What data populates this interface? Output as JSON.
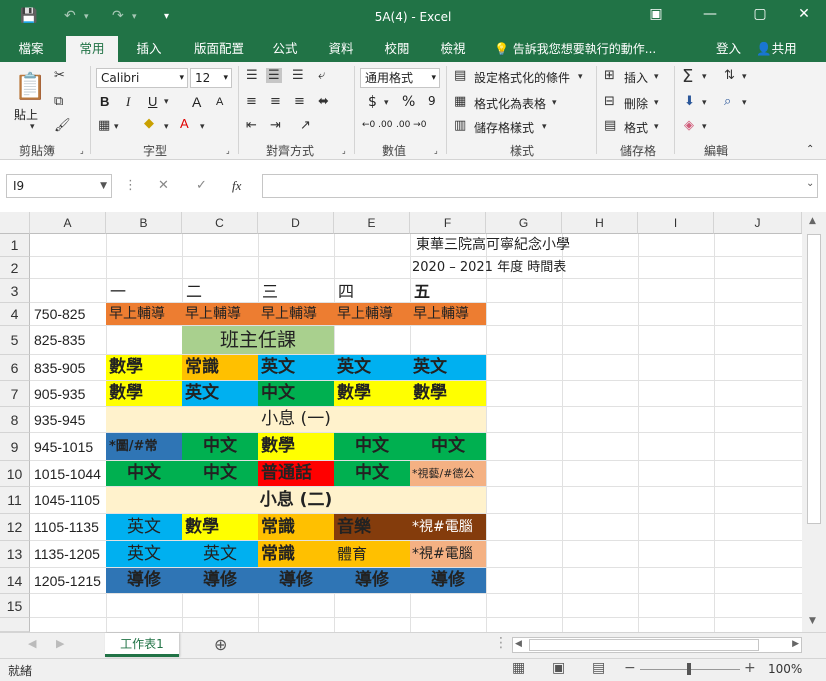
{
  "window": {
    "title": "5A(4)  -  Excel"
  },
  "qa": {
    "save_icon": "save-icon",
    "undo_icon": "undo-icon",
    "redo_icon": "redo-icon",
    "customize_icon": "customize-icon"
  },
  "ribbon_tabs": [
    "檔案",
    "常用",
    "插入",
    "版面配置",
    "公式",
    "資料",
    "校閱",
    "檢視"
  ],
  "tell_me": "告訴我您想要執行的動作...",
  "account": {
    "signin": "登入",
    "share": "共用"
  },
  "ribbon": {
    "clipboard": {
      "paste": "貼上",
      "label": "剪貼簿"
    },
    "font": {
      "name": "Calibri",
      "size": "12",
      "label": "字型",
      "bold": "B",
      "italic": "I",
      "underline": "U",
      "grow": "A",
      "shrink": "A"
    },
    "alignment": {
      "label": "對齊方式"
    },
    "number": {
      "format": "通用格式",
      "currency": "$",
      "percent": "%",
      "comma": "9",
      "inc": "←0 .00",
      "dec": ".00 →0",
      "label": "數值"
    },
    "styles": {
      "conditional": "設定格式化的條件",
      "table": "格式化為表格",
      "cell": "儲存格樣式",
      "label": "樣式"
    },
    "cells": {
      "insert": "插入",
      "delete": "刪除",
      "format": "格式",
      "label": "儲存格"
    },
    "editing": {
      "label": "編輯"
    }
  },
  "formula_bar": {
    "namebox": "I9",
    "value": ""
  },
  "columns": [
    "A",
    "B",
    "C",
    "D",
    "E",
    "F",
    "G",
    "H",
    "I",
    "J"
  ],
  "rows": [
    "1",
    "2",
    "3",
    "4",
    "5",
    "6",
    "7",
    "8",
    "9",
    "10",
    "11",
    "12",
    "13",
    "14",
    "15"
  ],
  "sheet": {
    "title1": "東華三院高可寧紀念小學",
    "title2": "2020 – 2021 年度  時間表",
    "days": [
      "一",
      "二",
      "三",
      "四",
      "五"
    ],
    "times": [
      "750-825",
      "825-835",
      "835-905",
      "905-935",
      "935-945",
      "945-1015",
      "1015-1044",
      "1045-1105",
      "1105-1135",
      "1135-1205",
      "1205-1215"
    ],
    "row4": [
      "早上輔導",
      "早上輔導",
      "早上輔導",
      "早上輔導",
      "早上輔導"
    ],
    "row5": "班主任課",
    "row6": [
      "數學",
      "常識",
      "英文",
      "英文",
      "英文"
    ],
    "row7": [
      "數學",
      "英文",
      "中文",
      "數學",
      "數學"
    ],
    "row8": "小息 (一)",
    "row9": [
      "*圖/#常",
      "中文",
      "數學",
      "中文",
      "中文"
    ],
    "row10": [
      "中文",
      "中文",
      "普通話",
      "中文",
      "*視藝/#德公"
    ],
    "row11": "小息 (二)",
    "row12": [
      "英文",
      "數學",
      "常識",
      "音樂",
      "*視#電腦"
    ],
    "row13": [
      "英文",
      "英文",
      "常識",
      "體育",
      "*視#電腦"
    ],
    "row14": [
      "導修",
      "導修",
      "導修",
      "導修",
      "導修"
    ]
  },
  "sheet_tab": "工作表1",
  "status": {
    "ready": "就緒",
    "zoom": "100%"
  },
  "colors": {
    "excel_green": "#217346",
    "orange": "#ed7d31",
    "light_green": "#a9d08e",
    "yellow": "#ffff00",
    "gold": "#ffc000",
    "sky": "#00b0f0",
    "green": "#00b050",
    "cream": "#fff2cc",
    "red": "#ff0000",
    "steel": "#2f75b5",
    "brown": "#843c0c",
    "peach": "#f4b183"
  }
}
